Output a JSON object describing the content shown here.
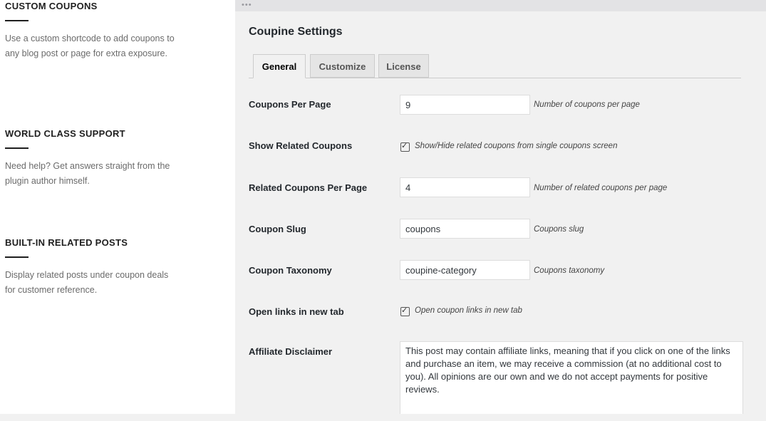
{
  "features": [
    {
      "title": "CUSTOM COUPONS",
      "text": "Use a custom shortcode to add coupons to any blog post or page for extra exposure."
    },
    {
      "title": "WORLD CLASS SUPPORT",
      "text": "Need help? Get answers straight from the plugin author himself."
    },
    {
      "title": "BUILT-IN RELATED POSTS",
      "text": "Display related posts under coupon deals for customer reference."
    }
  ],
  "panel": {
    "dots": "•••",
    "title": "Coupine Settings",
    "tabs": [
      {
        "label": "General",
        "active": true
      },
      {
        "label": "Customize",
        "active": false
      },
      {
        "label": "License",
        "active": false
      }
    ],
    "settings": {
      "coupons_per_page": {
        "label": "Coupons Per Page",
        "value": "9",
        "desc": "Number of coupons per page"
      },
      "show_related": {
        "label": "Show Related Coupons",
        "checked": true,
        "desc": "Show/Hide related coupons from single coupons screen"
      },
      "related_per_page": {
        "label": "Related Coupons Per Page",
        "value": "4",
        "desc": "Number of related coupons per page"
      },
      "coupon_slug": {
        "label": "Coupon Slug",
        "value": "coupons",
        "desc": "Coupons slug"
      },
      "coupon_taxonomy": {
        "label": "Coupon Taxonomy",
        "value": "coupine-category",
        "desc": "Coupons taxonomy"
      },
      "open_new_tab": {
        "label": "Open links in new tab",
        "checked": true,
        "desc": "Open coupon links in new tab"
      },
      "affiliate_disclaimer": {
        "label": "Affiliate Disclaimer",
        "value": "This post may contain affiliate links, meaning that if you click on one of the links and purchase an item, we may receive a commission (at no additional cost to you). All opinions are our own and we do not accept payments for positive reviews."
      }
    }
  },
  "icons": {
    "checkbox": "checkbox-icon",
    "check": "✓"
  }
}
